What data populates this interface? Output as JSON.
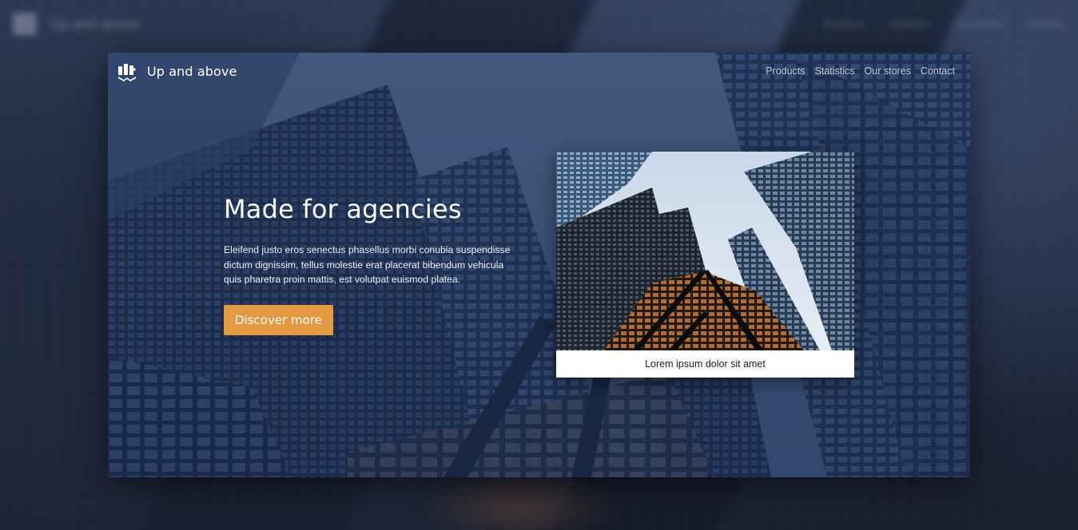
{
  "brand": {
    "name": "Up and above",
    "logo_icon": "bookshelf-people-icon"
  },
  "nav": {
    "items": [
      {
        "label": "Products"
      },
      {
        "label": "Statistics"
      },
      {
        "label": "Our stores"
      },
      {
        "label": "Contact"
      }
    ]
  },
  "hero": {
    "title": "Made for agencies",
    "description": "Eleifend justo eros senectus phasellus morbi conubia suspendisse dictum dignissim, tellus molestie erat placerat bibendum vehicula quis pharetra proin mattis, est volutpat euismod platea.",
    "cta_label": "Discover more"
  },
  "photo_card": {
    "caption": "Lorem ipsum dolor sit amet"
  },
  "colors": {
    "accent": "#e49a41",
    "overlay": "#1f3256",
    "nav_text": "#c3cbd8"
  }
}
